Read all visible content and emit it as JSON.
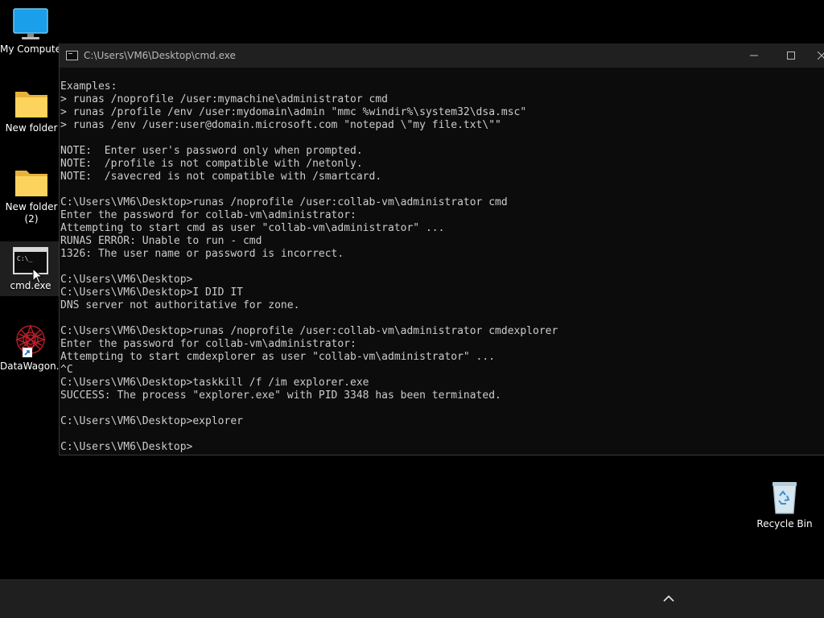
{
  "desktop": {
    "icons": [
      {
        "label": "My Computer",
        "icon": "monitor-icon"
      },
      {
        "label": "New folder",
        "icon": "folder-icon"
      },
      {
        "label": "New folder\n(2)",
        "label_line1": "New folder",
        "label_line2": "(2)",
        "icon": "folder-icon"
      },
      {
        "label": "cmd.exe",
        "icon": "cmd-icon",
        "selected": true
      },
      {
        "label": "DataWagon...",
        "icon": "datawagon-shortcut-icon"
      },
      {
        "label": "Recycle Bin",
        "icon": "recycle-bin-icon"
      }
    ]
  },
  "cmd_window": {
    "title": "C:\\Users\\VM6\\Desktop\\cmd.exe",
    "minimize_label": "—",
    "maximize_label": "☐",
    "close_label": "✕",
    "lines": [
      "Examples:",
      "> runas /noprofile /user:mymachine\\administrator cmd",
      "> runas /profile /env /user:mydomain\\admin \"mmc %windir%\\system32\\dsa.msc\"",
      "> runas /env /user:user@domain.microsoft.com \"notepad \\\"my file.txt\\\"\"",
      "",
      "NOTE:  Enter user's password only when prompted.",
      "NOTE:  /profile is not compatible with /netonly.",
      "NOTE:  /savecred is not compatible with /smartcard.",
      "",
      "C:\\Users\\VM6\\Desktop>runas /noprofile /user:collab-vm\\administrator cmd",
      "Enter the password for collab-vm\\administrator:",
      "Attempting to start cmd as user \"collab-vm\\administrator\" ...",
      "RUNAS ERROR: Unable to run - cmd",
      "1326: The user name or password is incorrect.",
      "",
      "C:\\Users\\VM6\\Desktop>",
      "C:\\Users\\VM6\\Desktop>I DID IT",
      "DNS server not authoritative for zone.",
      "",
      "C:\\Users\\VM6\\Desktop>runas /noprofile /user:collab-vm\\administrator cmdexplorer",
      "Enter the password for collab-vm\\administrator:",
      "Attempting to start cmdexplorer as user \"collab-vm\\administrator\" ...",
      "^C",
      "C:\\Users\\VM6\\Desktop>taskkill /f /im explorer.exe",
      "SUCCESS: The process \"explorer.exe\" with PID 3348 has been terminated.",
      "",
      "C:\\Users\\VM6\\Desktop>explorer",
      "",
      "C:\\Users\\VM6\\Desktop>"
    ]
  },
  "taskbar": {
    "tray_icon": "chevron-up-icon"
  },
  "colors": {
    "desktop_bg": "#000000",
    "console_bg": "#0c0c0c",
    "console_text": "#cccccc",
    "titlebar_bg": "#202020",
    "taskbar_bg": "#1f1f1f"
  }
}
